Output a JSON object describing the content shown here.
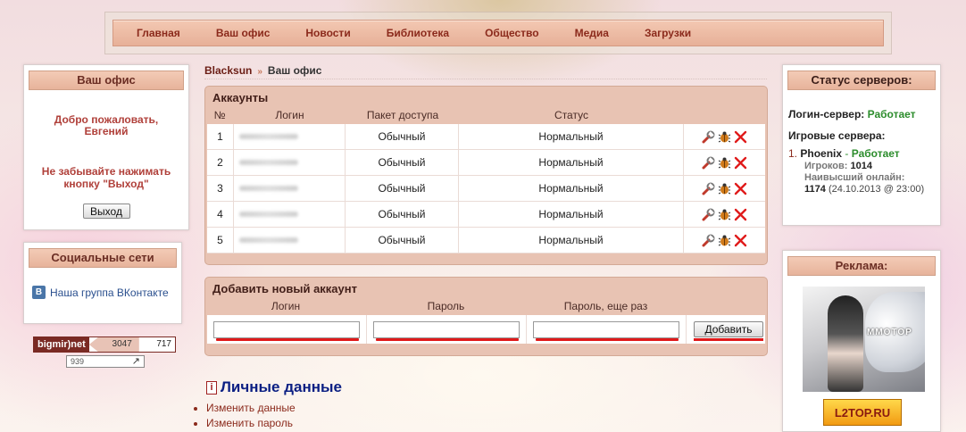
{
  "nav": [
    "Главная",
    "Ваш офис",
    "Новости",
    "Библиотека",
    "Общество",
    "Медиа",
    "Загрузки"
  ],
  "office": {
    "title": "Ваш офис",
    "welcome_line1": "Добро пожаловать,",
    "welcome_line2": "Евгений",
    "reminder_line1": "Не забывайте нажимать",
    "reminder_line2": "кнопку \"Выход\"",
    "logout_label": "Выход"
  },
  "social": {
    "title": "Социальные сети",
    "vk_icon": "В",
    "vk_label": "Наша группа ВКонтакте"
  },
  "counter": {
    "brand": "bigmir)net",
    "value1": "3047",
    "value2": "717",
    "value3": "939"
  },
  "breadcrumb": {
    "home": "Blacksun",
    "separator": "»",
    "current": "Ваш офис"
  },
  "accounts": {
    "title": "Аккаунты",
    "columns": [
      "№",
      "Логин",
      "Пакет доступа",
      "Статус"
    ],
    "rows": [
      {
        "num": "1",
        "package": "Обычный",
        "status": "Нормальный"
      },
      {
        "num": "2",
        "package": "Обычный",
        "status": "Нормальный"
      },
      {
        "num": "3",
        "package": "Обычный",
        "status": "Нормальный"
      },
      {
        "num": "4",
        "package": "Обычный",
        "status": "Нормальный"
      },
      {
        "num": "5",
        "package": "Обычный",
        "status": "Нормальный"
      }
    ],
    "row_icons": [
      "wrench-icon",
      "bug-icon",
      "delete-x-icon"
    ]
  },
  "add_account": {
    "title": "Добавить новый аккаунт",
    "columns": [
      "Логин",
      "Пароль",
      "Пароль, еще раз"
    ],
    "login_value": "",
    "password_value": "",
    "password_repeat_value": "",
    "submit_label": "Добавить"
  },
  "personal": {
    "icon": "i",
    "title": "Личные данные",
    "links": [
      "Изменить данные",
      "Изменить пароль"
    ]
  },
  "server_status": {
    "title": "Статус серверов:",
    "login_label": "Логин-сервер:",
    "login_state": "Работает",
    "game_label": "Игровые сервера:",
    "server": {
      "index": "1.",
      "name": "Phoenix",
      "sep": "-",
      "state": "Работает",
      "players_label": "Игроков:",
      "players": "1014",
      "peak_label": "Наивысший онлайн:",
      "peak": "1174",
      "peak_date": "(24.10.2013 @ 23:00)"
    }
  },
  "ads": {
    "title": "Реклама:",
    "banner_text": "MMOTOP",
    "l2top_text": "L2TOP.RU"
  },
  "colors": {
    "accent": "#8b2a1c",
    "ok": "#2b8c2b",
    "header_bg": "#e8c3b3"
  }
}
